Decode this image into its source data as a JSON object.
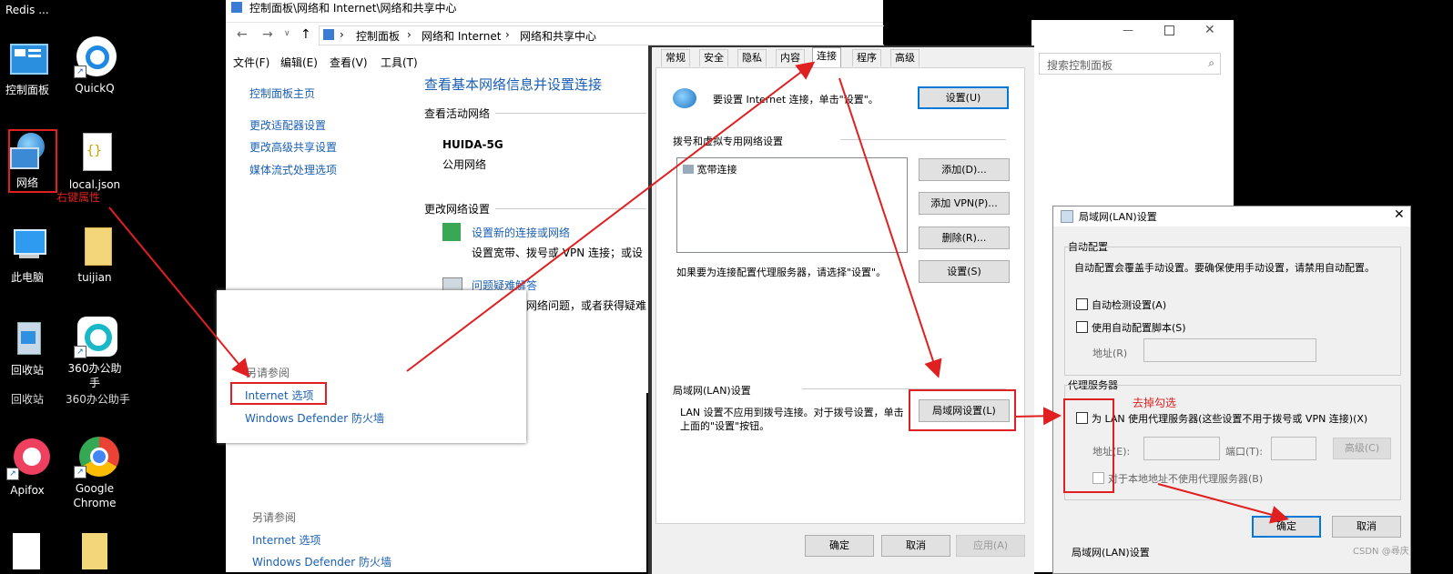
{
  "desktop": {
    "top_label": "Redis ...",
    "icons": [
      {
        "name": "control-panel",
        "label": "控制面板"
      },
      {
        "name": "quickq",
        "label": "QuickQ"
      },
      {
        "name": "network",
        "label": "网络"
      },
      {
        "name": "local-json",
        "label": "local.json"
      },
      {
        "name": "this-pc",
        "label": "此电脑"
      },
      {
        "name": "tuijian",
        "label": "tuijian"
      },
      {
        "name": "recycle-bin",
        "label": "回收站"
      },
      {
        "name": "360-assistant",
        "label": "360办公助手"
      },
      {
        "name": "apifox",
        "label": "Apifox"
      },
      {
        "name": "google-chrome",
        "label": "Google Chrome"
      }
    ],
    "ghost_labels": [
      "回收站",
      "360办公助手"
    ]
  },
  "annotations": {
    "right_click_props": "右键属性",
    "uncheck": "去掉勾选",
    "watermark": "CSDN @尋庆"
  },
  "control_panel": {
    "title": "控制面板\\网络和 Internet\\网络和共享中心",
    "breadcrumb": [
      "控制面板",
      "网络和 Internet",
      "网络和共享中心"
    ],
    "menu": [
      "文件(F)",
      "编辑(E)",
      "查看(V)",
      "工具(T)"
    ],
    "sidebar": [
      "控制面板主页",
      "更改适配器设置",
      "更改高级共享设置",
      "媒体流式处理选项"
    ],
    "heading": "查看基本网络信息并设置连接",
    "active_network_label": "查看活动网络",
    "network_name": "HUIDA-5G",
    "network_type": "公用网络",
    "change_settings_label": "更改网络设置",
    "new_conn_link": "设置新的连接或网络",
    "new_conn_desc": "设置宽带、拨号或 VPN 连接；或设",
    "troubleshoot_link": "问题疑难解答",
    "troubleshoot_desc": "网络问题，或者获得疑难",
    "see_also": "另请参阅",
    "see_also_items": [
      "Internet 选项",
      "Windows Defender 防火墙"
    ]
  },
  "popup": {
    "see_also": "另请参阅",
    "internet_options": "Internet 选项",
    "firewall": "Windows Defender 防火墙"
  },
  "search": {
    "placeholder": "搜索控制面板"
  },
  "inet_props": {
    "tabs": [
      "常规",
      "安全",
      "隐私",
      "内容",
      "连接",
      "程序",
      "高级"
    ],
    "active_tab": "连接",
    "setup_text": "要设置 Internet 连接，单击\"设置\"。",
    "setup_btn": "设置(U)",
    "dialup_section": "拨号和虚拟专用网络设置",
    "dialup_items": [
      "宽带连接"
    ],
    "add_btn": "添加(D)...",
    "add_vpn_btn": "添加 VPN(P)...",
    "remove_btn": "删除(R)...",
    "settings_btn": "设置(S)",
    "proxy_hint": "如果要为连接配置代理服务器，请选择\"设置\"。",
    "lan_section": "局域网(LAN)设置",
    "lan_desc_1": "LAN 设置不应用到拨号连接。对于拨号设置，单击",
    "lan_desc_2": "上面的\"设置\"按钮。",
    "lan_btn": "局域网设置(L)",
    "ok": "确定",
    "cancel": "取消",
    "apply": "应用(A)"
  },
  "lan_dialog": {
    "title": "局域网(LAN)设置",
    "auto_config": "自动配置",
    "auto_desc": "自动配置会覆盖手动设置。要确保使用手动设置，请禁用自动配置。",
    "auto_detect": "自动检测设置(A)",
    "use_script": "使用自动配置脚本(S)",
    "address_r": "地址(R)",
    "proxy_server": "代理服务器",
    "use_proxy": "为 LAN 使用代理服务器(这些设置不用于拨号或 VPN 连接)(X)",
    "address_e": "地址(E):",
    "port": "端口(T):",
    "advanced": "高级(C)",
    "bypass_local": "对于本地地址不使用代理服务器(B)",
    "ok": "确定",
    "cancel": "取消",
    "behind_label": "局域网(LAN)设置"
  },
  "colors": {
    "accent": "#0078d7",
    "link": "#1a5fb4",
    "annotation": "#e02020"
  }
}
